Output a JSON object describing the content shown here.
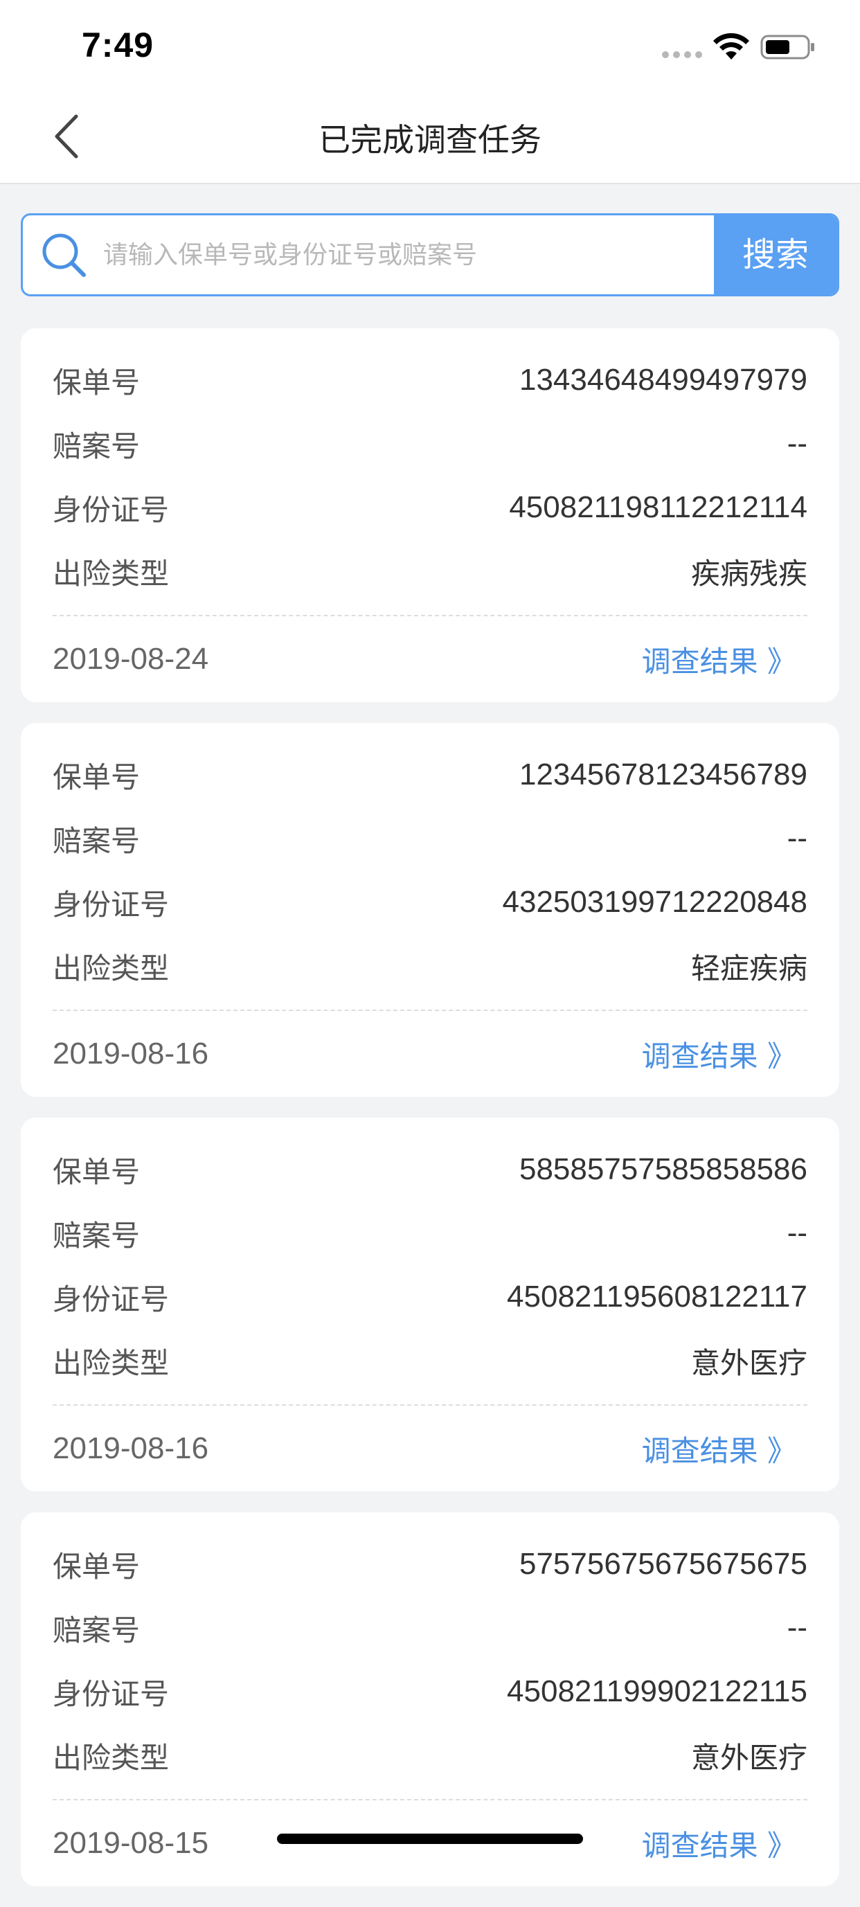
{
  "status_bar": {
    "time": "7:49",
    "icons": [
      "signal-icon",
      "wifi-icon",
      "battery-icon"
    ]
  },
  "nav": {
    "back_icon": "chevron-left-icon",
    "title": "已完成调查任务"
  },
  "search": {
    "icon": "search-icon",
    "placeholder": "请输入保单号或身份证号或赔案号",
    "value": "",
    "button_label": "搜索"
  },
  "labels": {
    "policy_no": "保单号",
    "claim_no": "赔案号",
    "id_no": "身份证号",
    "risk_type": "出险类型",
    "result_link": "调查结果 》"
  },
  "cards": [
    {
      "policy_no": "13434648499497979",
      "claim_no": "--",
      "id_no": "450821198112212114",
      "risk_type": "疾病残疾",
      "date": "2019-08-24"
    },
    {
      "policy_no": "12345678123456789",
      "claim_no": "--",
      "id_no": "432503199712220848",
      "risk_type": "轻症疾病",
      "date": "2019-08-16"
    },
    {
      "policy_no": "58585757585858586",
      "claim_no": "--",
      "id_no": "450821195608122117",
      "risk_type": "意外医疗",
      "date": "2019-08-16"
    },
    {
      "policy_no": "57575675675675675",
      "claim_no": "--",
      "id_no": "450821199902122115",
      "risk_type": "意外医疗",
      "date": "2019-08-15"
    }
  ],
  "colors": {
    "accent": "#5aa0f3",
    "link": "#4a90e2",
    "background": "#f2f3f5",
    "card": "#ffffff"
  }
}
